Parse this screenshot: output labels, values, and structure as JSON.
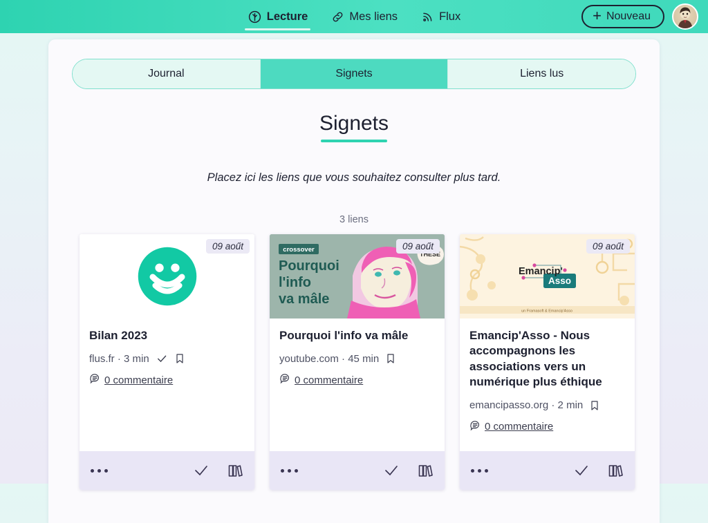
{
  "header": {
    "nav": [
      {
        "label": "Lecture",
        "icon": "tree-circle-icon",
        "active": true
      },
      {
        "label": "Mes liens",
        "icon": "link-icon",
        "active": false
      },
      {
        "label": "Flux",
        "icon": "rss-icon",
        "active": false
      }
    ],
    "new_button": {
      "label": "Nouveau",
      "icon": "plus-icon"
    },
    "avatar": "user-avatar"
  },
  "tabs": [
    {
      "label": "Journal",
      "active": false
    },
    {
      "label": "Signets",
      "active": true
    },
    {
      "label": "Liens lus",
      "active": false
    }
  ],
  "page": {
    "title": "Signets",
    "subtitle": "Placez ici les liens que vous souhaitez consulter plus tard.",
    "count": "3 liens"
  },
  "cards": [
    {
      "date": "09 aoűt",
      "title": "Bilan 2023",
      "source": "flus.fr · 3 min",
      "comments": "0 commentaire",
      "has_check": true,
      "has_bookmark": true,
      "thumb_type": "flus-logo"
    },
    {
      "date": "09 aoűt",
      "title": "Pourquoi l'info va mâle",
      "source": "youtube.com · 45 min",
      "comments": "0 commentaire",
      "has_check": false,
      "has_bookmark": true,
      "thumb_type": "youtube-thumbnail",
      "thumb_badge": "crossover",
      "thumb_text": "Pourquoi l'info va mâle"
    },
    {
      "date": "09 aoűt",
      "title": "Emancip'Asso - Nous accompagnons les associations vers un numérique plus éthique",
      "source": "emancipasso.org · 2 min",
      "comments": "0 commentaire",
      "has_check": false,
      "has_bookmark": true,
      "thumb_type": "emancipasso-logo",
      "thumb_text_1": "Emancip'",
      "thumb_text_2": "Asso"
    }
  ],
  "footer_actions": {
    "menu": "more-options",
    "mark_read": "mark-as-read",
    "library": "add-to-collection"
  },
  "colors": {
    "accent": "#2ed3b1",
    "header": "#4ce0c2",
    "footer_bg": "#e9e6f6",
    "text": "#1d2030"
  }
}
